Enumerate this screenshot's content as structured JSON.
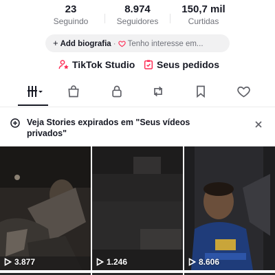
{
  "stats": [
    {
      "value": "23",
      "label": "Seguindo"
    },
    {
      "value": "8.974",
      "label": "Seguidores"
    },
    {
      "value": "150,7 mil",
      "label": "Curtidas"
    }
  ],
  "bio": {
    "add_plus": "+",
    "add_label": "Add biografia",
    "separator": "·",
    "interest_label": "Tenho interesse em..."
  },
  "links": {
    "studio": "TikTok Studio",
    "orders": "Seus pedidos"
  },
  "tabs": [
    {
      "icon": "grid-icon",
      "active": true
    },
    {
      "icon": "shopping-bag-icon",
      "active": false
    },
    {
      "icon": "lock-icon",
      "active": false
    },
    {
      "icon": "repost-icon",
      "active": false
    },
    {
      "icon": "bookmark-icon",
      "active": false
    },
    {
      "icon": "heart-icon",
      "active": false
    }
  ],
  "banner": {
    "text": "Veja Stories expirados em \"Seus vídeos privados\"",
    "close": "×"
  },
  "videos": [
    {
      "views": "3.877"
    },
    {
      "views": "1.246"
    },
    {
      "views": "8.606"
    }
  ],
  "colors": {
    "text": "#161823",
    "secondary": "#6f7179",
    "pill_bg": "#f1f1f2",
    "accent_red": "#fe2c55"
  }
}
